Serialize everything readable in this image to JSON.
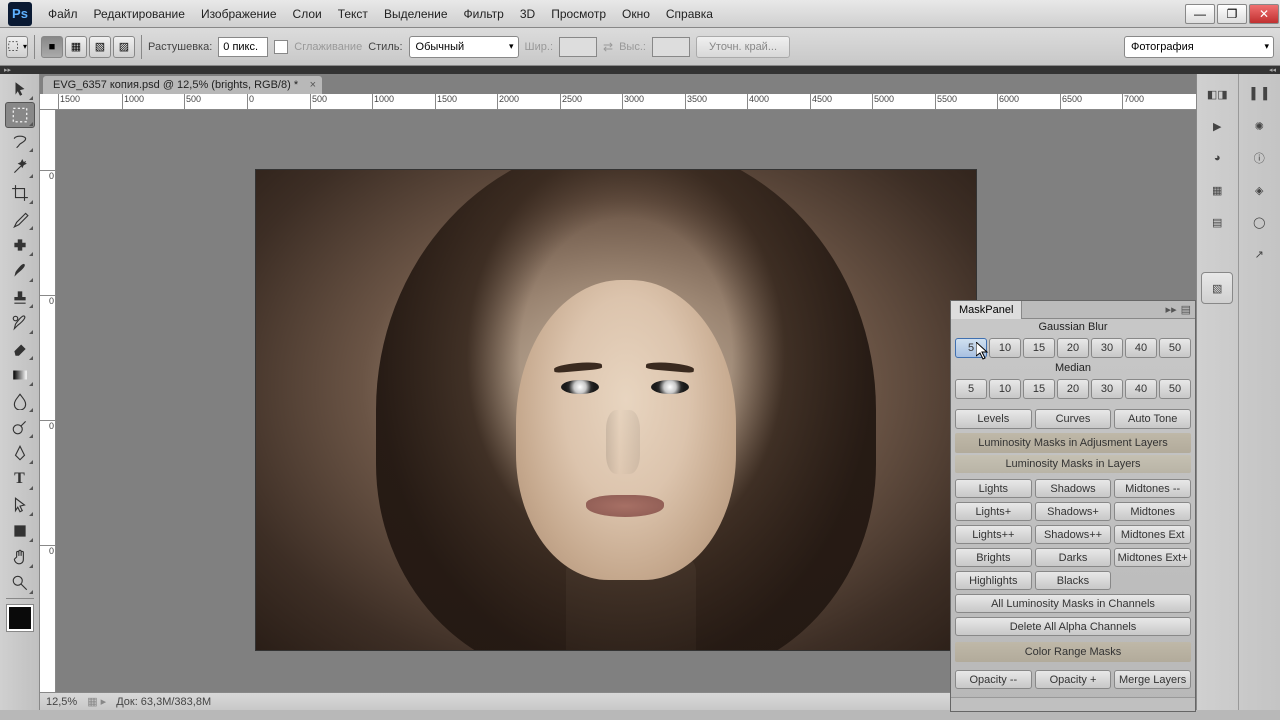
{
  "menubar": [
    "Файл",
    "Редактирование",
    "Изображение",
    "Слои",
    "Текст",
    "Выделение",
    "Фильтр",
    "3D",
    "Просмотр",
    "Окно",
    "Справка"
  ],
  "window_controls": {
    "min": "—",
    "max": "❐",
    "close": "✕"
  },
  "options": {
    "feather_label": "Растушевка:",
    "feather_value": "0 пикс.",
    "antialias": "Сглаживание",
    "style_label": "Стиль:",
    "style_value": "Обычный",
    "width_label": "Шир.:",
    "height_label": "Выс.:",
    "refine": "Уточн. край...",
    "workspace": "Фотография"
  },
  "doc_tab": "EVG_6357 копия.psd @ 12,5% (brights, RGB/8) *",
  "ruler_h": [
    "1500",
    "1000",
    "500",
    "0",
    "500",
    "1000",
    "1500",
    "2000",
    "2500",
    "3000",
    "3500",
    "4000",
    "4500",
    "5000",
    "5500",
    "6000",
    "6500",
    "7000"
  ],
  "ruler_v": [
    "0",
    "0",
    "0",
    "0"
  ],
  "status": {
    "zoom": "12,5%",
    "doc": "Док: 63,3M/383,8M"
  },
  "maskpanel": {
    "title": "MaskPanel",
    "gblur": "Gaussian Blur",
    "median": "Median",
    "nums": [
      "5",
      "10",
      "15",
      "20",
      "30",
      "40",
      "50"
    ],
    "levels": "Levels",
    "curves": "Curves",
    "autotone": "Auto Tone",
    "band1": "Luminosity Masks in Adjusment Layers",
    "band2": "Luminosity Masks in Layers",
    "lights": "Lights",
    "shadows": "Shadows",
    "midminus": "Midtones --",
    "lightsp": "Lights+",
    "shadowsp": "Shadows+",
    "mid": "Midtones",
    "lightspp": "Lights++",
    "shadowspp": "Shadows++",
    "midext": "Midtones Ext",
    "brights": "Brights",
    "darks": "Darks",
    "midextp": "Midtones Ext+",
    "highlights": "Highlights",
    "blacks": "Blacks",
    "allchan": "All Luminosity Masks in Channels",
    "delalpha": "Delete All Alpha Channels",
    "colorrange": "Color Range Masks",
    "opminus": "Opacity --",
    "opplus": "Opacity +",
    "merge": "Merge Layers"
  }
}
